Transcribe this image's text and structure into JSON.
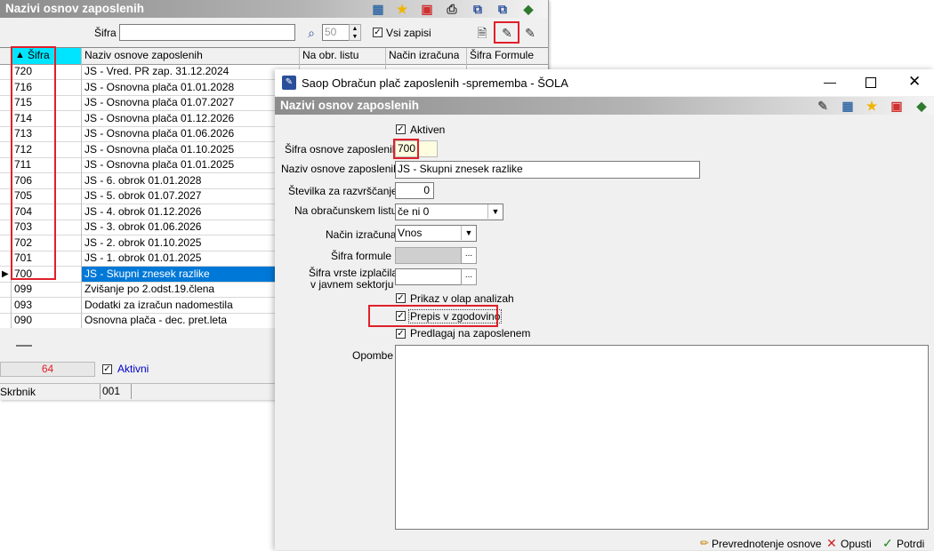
{
  "back_window": {
    "title": "Nazivi osnov zaposlenih",
    "search_label": "Šifra",
    "record_count_field": "50",
    "all_records_label": "Vsi zapisi",
    "columns": [
      "Šifra",
      "Naziv osnove zaposlenih",
      "Na obr. listu",
      "Način izračuna",
      "Šifra Formule"
    ],
    "rows": [
      {
        "code": "720",
        "name": "JS - Vred. PR zap. 31.12.2024"
      },
      {
        "code": "716",
        "name": "JS - Osnovna plača 01.01.2028"
      },
      {
        "code": "715",
        "name": "JS - Osnovna plača 01.07.2027"
      },
      {
        "code": "714",
        "name": "JS - Osnovna plača 01.12.2026"
      },
      {
        "code": "713",
        "name": "JS - Osnovna plača 01.06.2026"
      },
      {
        "code": "712",
        "name": "JS - Osnovna plača 01.10.2025"
      },
      {
        "code": "711",
        "name": "JS - Osnovna plača 01.01.2025"
      },
      {
        "code": "706",
        "name": "JS - 6. obrok 01.01.2028"
      },
      {
        "code": "705",
        "name": "JS - 5. obrok 01.07.2027"
      },
      {
        "code": "704",
        "name": "JS - 4. obrok 01.12.2026"
      },
      {
        "code": "703",
        "name": "JS - 3. obrok 01.06.2026"
      },
      {
        "code": "702",
        "name": "JS - 2. obrok 01.10.2025"
      },
      {
        "code": "701",
        "name": "JS - 1. obrok 01.01.2025"
      },
      {
        "code": "700",
        "name": "JS - Skupni znesek razlike"
      },
      {
        "code": "099",
        "name": "Zvišanje po 2.odst.19.člena"
      },
      {
        "code": "093",
        "name": "Dodatki za izračun nadomestila"
      },
      {
        "code": "090",
        "name": "Osnovna plača - dec. pret.leta"
      }
    ],
    "selected_row_index": 13,
    "count_display": "64",
    "active_label": "Aktivni",
    "owner_label": "Skrbnik",
    "owner_value": "001",
    "colors": {
      "selection": "#0078d7",
      "highlight": "#e0202a",
      "count_text": "#e0202a",
      "active_text": "#0000c8"
    }
  },
  "dialog": {
    "window_title": "Saop Obračun plač zaposlenih -sprememba - ŠOLA",
    "subtitle": "Nazivi osnov zaposlenih",
    "active_label": "Aktiven",
    "code_label": "Šifra osnove zaposlenih",
    "code_value": "700",
    "name_label": "Naziv osnove zaposlenih",
    "name_value": "JS - Skupni znesek razlike",
    "sort_label": "Številka  za razvrščanje",
    "sort_value": "0",
    "payslip_label": "Na obračunskem listu",
    "payslip_value": "če ni 0",
    "method_label": "Način izračuna",
    "method_value": "Vnos",
    "formula_label": "Šifra formule",
    "payment_label_1": "Šifra vrste izplačila",
    "payment_label_2": "v javnem sektorju",
    "olap_label": "Prikaz v olap analizah",
    "history_label": "Prepis v zgodovino",
    "suggest_label": "Predlagaj na zaposlenem",
    "notes_label": "Opombe",
    "revalue_button": "Prevrednotenje osnove",
    "cancel_button": "Opusti",
    "confirm_button": "Potrdi",
    "ellipsis": "..."
  }
}
